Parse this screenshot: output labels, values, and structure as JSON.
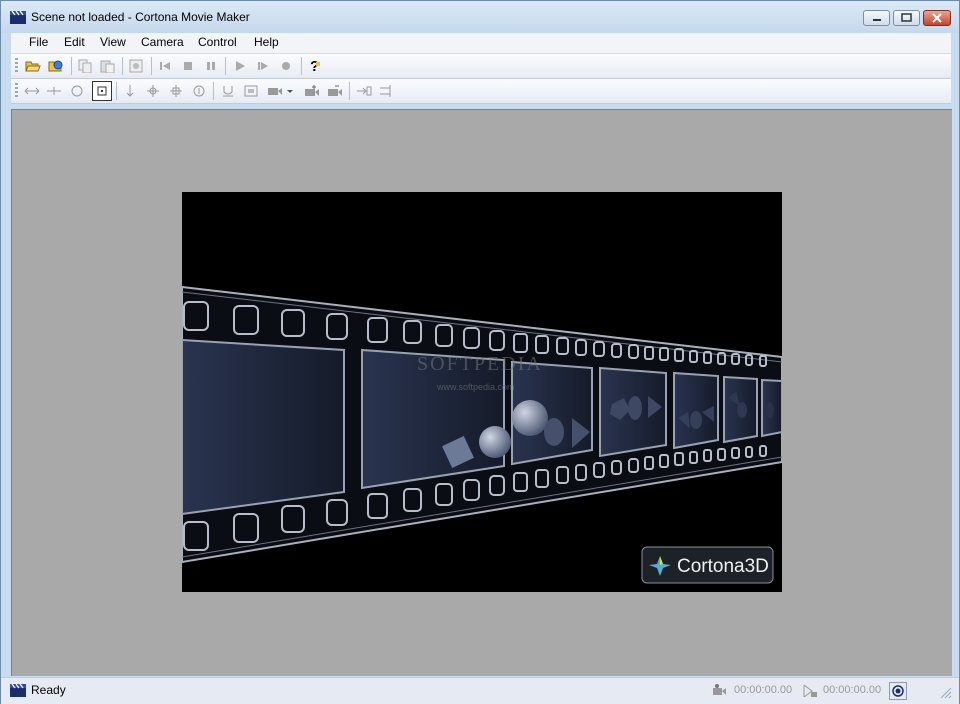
{
  "window": {
    "title": "Scene not loaded - Cortona Movie Maker"
  },
  "menu": [
    "File",
    "Edit",
    "View",
    "Camera",
    "Control",
    "Help"
  ],
  "viewport": {
    "watermark": "SOFTPEDIA",
    "watermark_url": "www.softpedia.com",
    "logo_text": "Cortona3D"
  },
  "status": {
    "text": "Ready",
    "time1": "00:00:00.00",
    "time2": "00:00:00.00"
  },
  "colors": {
    "viewport_bg": "#a9a9a9",
    "scene_bg": "#000000",
    "film_panel": "#1c2333"
  }
}
